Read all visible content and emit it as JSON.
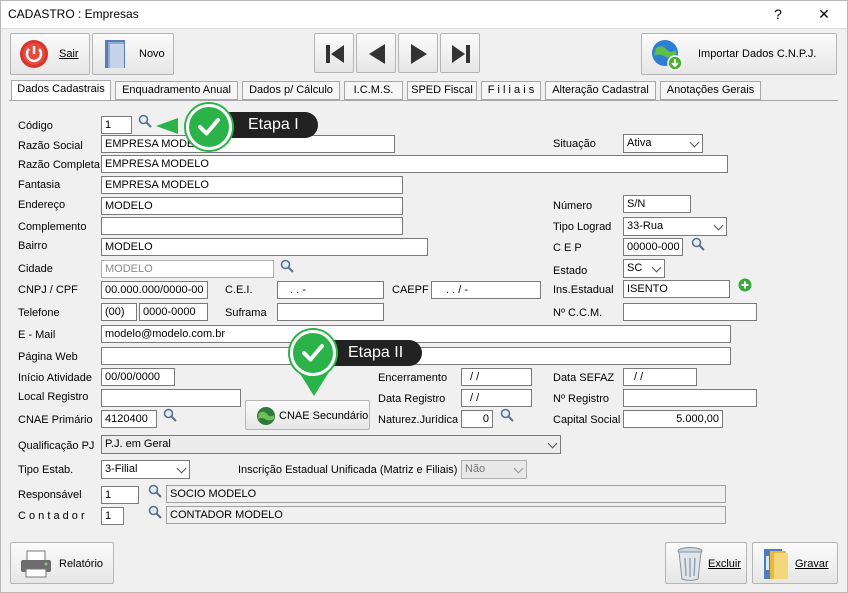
{
  "window": {
    "title": "CADASTRO : Empresas",
    "help": "?",
    "close": "✕"
  },
  "toolbar": {
    "exit_label": "Sair",
    "new_label": "Novo",
    "import_label": "Importar Dados C.N.P.J."
  },
  "tabs": [
    "Dados Cadastrais",
    "Enquadramento Anual",
    "Dados p/ Cálculo",
    "I.C.M.S.",
    "SPED Fiscal",
    "F i l i a i s",
    "Alteração Cadastral",
    "Anotações Gerais"
  ],
  "form": {
    "codigo": {
      "label": "Código",
      "value": "1"
    },
    "razao_social": {
      "label": "Razão Social",
      "value": "EMPRESA MODELO"
    },
    "razao_completa": {
      "label": "Razão Completa",
      "value": "EMPRESA MODELO"
    },
    "fantasia": {
      "label": "Fantasia",
      "value": "EMPRESA MODELO"
    },
    "endereco": {
      "label": "Endereço",
      "value": "MODELO"
    },
    "complemento": {
      "label": "Complemento",
      "value": ""
    },
    "bairro": {
      "label": "Bairro",
      "value": "MODELO"
    },
    "cidade": {
      "label": "Cidade",
      "value": "MODELO"
    },
    "cnpj": {
      "label": "CNPJ / CPF",
      "value": "00.000.000/0000-00"
    },
    "cei": {
      "label": "C.E.I.",
      "value": ".   .      -"
    },
    "caepf": {
      "label": "CAEPF",
      "value": ".   .   /   -"
    },
    "telefone": {
      "label": "Telefone",
      "ddd": "(00)",
      "value": "0000-0000"
    },
    "suframa": {
      "label": "Suframa",
      "value": ""
    },
    "email": {
      "label": "E - Mail",
      "value": "modelo@modelo.com.br"
    },
    "pagina_web": {
      "label": "Página Web",
      "value": ""
    },
    "inicio_atividade": {
      "label": "Início Atividade",
      "value": "00/00/0000"
    },
    "local_registro": {
      "label": "Local Registro",
      "value": ""
    },
    "cnae_primario": {
      "label": "CNAE Primário",
      "value": "4120400"
    },
    "cnae_secundario": {
      "label": "CNAE Secundário"
    },
    "encerramento": {
      "label": "Encerramento",
      "value": "/ /"
    },
    "data_registro": {
      "label": "Data Registro",
      "value": "/ /"
    },
    "natureza_juridica": {
      "label": "Naturez.Jurídica",
      "value": "0"
    },
    "situacao": {
      "label": "Situação",
      "value": "Ativa"
    },
    "numero": {
      "label": "Número",
      "value": "S/N"
    },
    "tipo_lograd": {
      "label": "Tipo Lograd",
      "value": "33-Rua"
    },
    "cep": {
      "label": "C E P",
      "value": "00000-000"
    },
    "estado": {
      "label": "Estado",
      "value": "SC"
    },
    "ins_estadual": {
      "label": "Ins.Estadual",
      "value": "ISENTO"
    },
    "ccm": {
      "label": "Nº C.C.M.",
      "value": ""
    },
    "data_sefaz": {
      "label": "Data SEFAZ",
      "value": "/ /"
    },
    "n_registro": {
      "label": "Nº Registro",
      "value": ""
    },
    "capital_social": {
      "label": "Capital Social",
      "value": "5.000,00"
    },
    "qualificacao_pj": {
      "label": "Qualificação PJ",
      "value": "P.J. em Geral"
    },
    "tipo_estab": {
      "label": "Tipo Estab.",
      "value": "3-Filial"
    },
    "inscricao_unificada": {
      "label": "Inscrição Estadual Unificada (Matriz e Filiais)",
      "value": "Não"
    },
    "responsavel": {
      "label": "Responsável",
      "code": "1",
      "name": "SOCIO MODELO"
    },
    "contador": {
      "label": "C o n t a d o r",
      "code": "1",
      "name": "CONTADOR MODELO"
    }
  },
  "callouts": {
    "etapa1": "Etapa I",
    "etapa2": "Etapa II"
  },
  "footer": {
    "report_label": "Relatório",
    "delete_label": "Excluir",
    "save_label": "Gravar"
  },
  "colors": {
    "accent_green": "#2bb34a",
    "callout_bg": "#222222"
  }
}
